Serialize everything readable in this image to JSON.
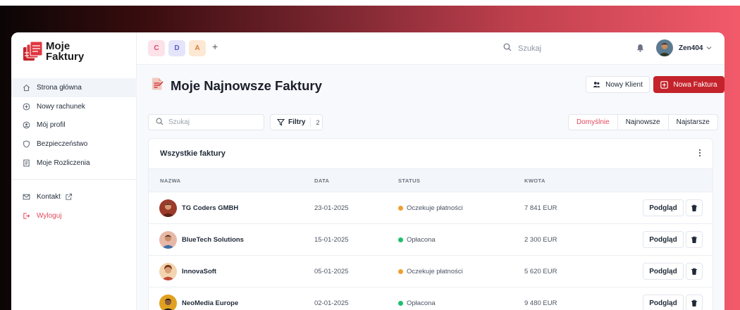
{
  "brand": {
    "line1": "Moje",
    "line2": "Faktury",
    "accent": "#c4232b"
  },
  "sidebar": {
    "items": [
      {
        "label": "Strona główna",
        "icon": "home-icon",
        "active": true
      },
      {
        "label": "Nowy rachunek",
        "icon": "plus-circle-icon"
      },
      {
        "label": "Mój profil",
        "icon": "user-circle-icon"
      },
      {
        "label": "Bezpieczeństwo",
        "icon": "shield-icon"
      },
      {
        "label": "Moje Rozliczenia",
        "icon": "ledger-icon"
      }
    ],
    "bottom": [
      {
        "label": "Kontakt",
        "icon": "mail-icon",
        "extra_icon": "external-link-icon"
      },
      {
        "label": "Wyloguj",
        "icon": "logout-icon"
      }
    ]
  },
  "topbar": {
    "workspaces": [
      "C",
      "D",
      "A"
    ],
    "add_label": "+",
    "search_placeholder": "Szukaj",
    "user_name": "Zen404"
  },
  "page": {
    "title": "Moje Najnowsze Faktury",
    "new_client_label": "Nowy Klient",
    "new_invoice_label": "Nowa Faktura"
  },
  "filters": {
    "search_placeholder": "Szukaj",
    "filters_label": "Filtry",
    "filters_count": "2",
    "sort_options": [
      "Domyślnie",
      "Najnowsze",
      "Najstarsze"
    ],
    "sort_active": "Domyślnie"
  },
  "table": {
    "title": "Wszystkie faktury",
    "columns": [
      "NAZWA",
      "DATA",
      "STATUS",
      "KWOTA"
    ],
    "view_label": "Podgląd",
    "rows": [
      {
        "name": "TG Coders GMBH",
        "date": "23-01-2025",
        "status": "Oczekuje płatności",
        "status_color": "#f0a030",
        "amount": "7 841 EUR"
      },
      {
        "name": "BlueTech Solutions",
        "date": "15-01-2025",
        "status": "Opłacona",
        "status_color": "#1fbf6e",
        "amount": "2 300 EUR"
      },
      {
        "name": "InnovaSoft",
        "date": "05-01-2025",
        "status": "Oczekuje płatności",
        "status_color": "#f0a030",
        "amount": "5 620 EUR"
      },
      {
        "name": "NeoMedia Europe",
        "date": "02-01-2025",
        "status": "Opłacona",
        "status_color": "#1fbf6e",
        "amount": "9 480 EUR"
      }
    ]
  }
}
